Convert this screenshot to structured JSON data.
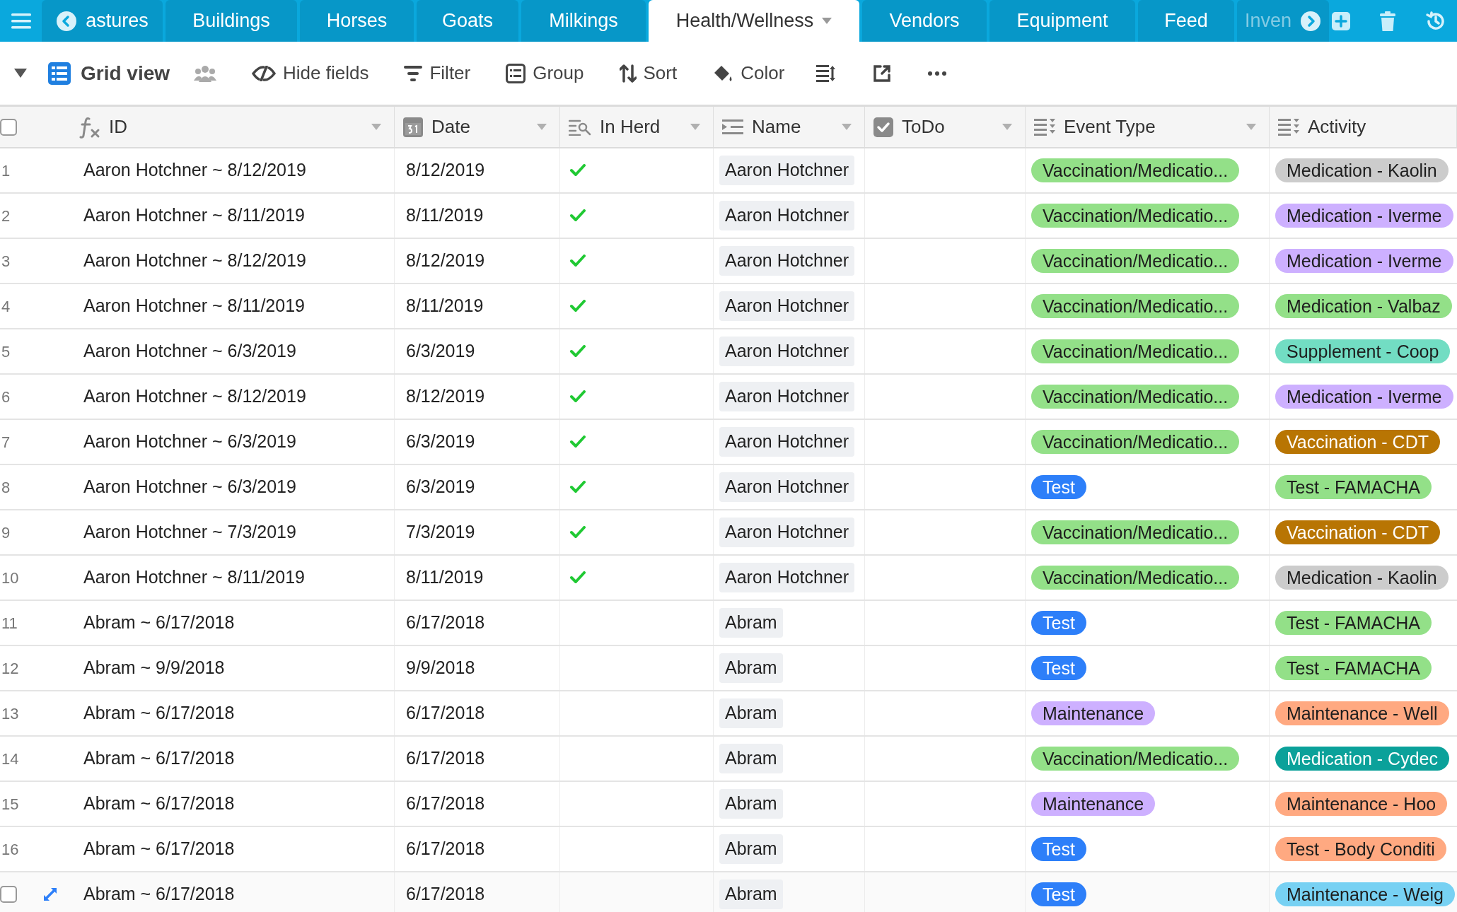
{
  "tabs": [
    {
      "label": "astures",
      "selected": false
    },
    {
      "label": "Buildings",
      "selected": false
    },
    {
      "label": "Horses",
      "selected": false
    },
    {
      "label": "Goats",
      "selected": false
    },
    {
      "label": "Milkings",
      "selected": false
    },
    {
      "label": "Health/Wellness",
      "selected": true
    },
    {
      "label": "Vendors",
      "selected": false
    },
    {
      "label": "Equipment",
      "selected": false
    },
    {
      "label": "Feed",
      "selected": false
    },
    {
      "label": "Inven",
      "selected": false
    }
  ],
  "select_all": {
    "checked": false
  },
  "view": {
    "name": "Grid view"
  },
  "toolbar": [
    {
      "label": "Hide fields",
      "kind": "hide"
    },
    {
      "label": "Filter",
      "kind": "filter"
    },
    {
      "label": "Group",
      "kind": "group"
    },
    {
      "label": "Sort",
      "kind": "sort"
    },
    {
      "label": "Color",
      "kind": "color"
    }
  ],
  "columns": [
    {
      "label": "ID",
      "kind": "formula"
    },
    {
      "label": "Date",
      "kind": "date"
    },
    {
      "label": "In Herd",
      "kind": "lookup"
    },
    {
      "label": "Name",
      "kind": "link"
    },
    {
      "label": "ToDo",
      "kind": "checkbox"
    },
    {
      "label": "Event Type",
      "kind": "select"
    },
    {
      "label": "Activity",
      "kind": "select"
    }
  ],
  "rows": [
    {
      "number": "1",
      "hovered": false,
      "id": "Aaron Hotchner ~ 8/12/2019",
      "date": "8/12/2019",
      "in_herd": true,
      "name": "Aaron Hotchner",
      "event_type": {
        "label": "Vaccination/Medicatio...",
        "color": "#93e088"
      },
      "activity": {
        "label": "Medication - Kaolin",
        "color": "#cccccc"
      }
    },
    {
      "number": "2",
      "hovered": false,
      "id": "Aaron Hotchner ~ 8/11/2019",
      "date": "8/11/2019",
      "in_herd": true,
      "name": "Aaron Hotchner",
      "event_type": {
        "label": "Vaccination/Medicatio...",
        "color": "#93e088"
      },
      "activity": {
        "label": "Medication - Iverme",
        "color": "#cdb0ff"
      }
    },
    {
      "number": "3",
      "hovered": false,
      "id": "Aaron Hotchner ~ 8/12/2019",
      "date": "8/12/2019",
      "in_herd": true,
      "name": "Aaron Hotchner",
      "event_type": {
        "label": "Vaccination/Medicatio...",
        "color": "#93e088"
      },
      "activity": {
        "label": "Medication - Iverme",
        "color": "#cdb0ff"
      }
    },
    {
      "number": "4",
      "hovered": false,
      "id": "Aaron Hotchner ~ 8/11/2019",
      "date": "8/11/2019",
      "in_herd": true,
      "name": "Aaron Hotchner",
      "event_type": {
        "label": "Vaccination/Medicatio...",
        "color": "#93e088"
      },
      "activity": {
        "label": "Medication - Valbaz",
        "color": "#93e088"
      }
    },
    {
      "number": "5",
      "hovered": false,
      "id": "Aaron Hotchner ~ 6/3/2019",
      "date": "6/3/2019",
      "in_herd": true,
      "name": "Aaron Hotchner",
      "event_type": {
        "label": "Vaccination/Medicatio...",
        "color": "#93e088"
      },
      "activity": {
        "label": "Supplement - Coop",
        "color": "#72ddc3"
      }
    },
    {
      "number": "6",
      "hovered": false,
      "id": "Aaron Hotchner ~ 8/12/2019",
      "date": "8/12/2019",
      "in_herd": true,
      "name": "Aaron Hotchner",
      "event_type": {
        "label": "Vaccination/Medicatio...",
        "color": "#93e088"
      },
      "activity": {
        "label": "Medication - Iverme",
        "color": "#cdb0ff"
      }
    },
    {
      "number": "7",
      "hovered": false,
      "id": "Aaron Hotchner ~ 6/3/2019",
      "date": "6/3/2019",
      "in_herd": true,
      "name": "Aaron Hotchner",
      "event_type": {
        "label": "Vaccination/Medicatio...",
        "color": "#93e088"
      },
      "activity": {
        "label": "Vaccination - CDT",
        "color": "#b87503"
      }
    },
    {
      "number": "8",
      "hovered": false,
      "id": "Aaron Hotchner ~ 6/3/2019",
      "date": "6/3/2019",
      "in_herd": true,
      "name": "Aaron Hotchner",
      "event_type": {
        "label": "Test",
        "color": "#2d7ff9"
      },
      "activity": {
        "label": "Test - FAMACHA",
        "color": "#93e088"
      }
    },
    {
      "number": "9",
      "hovered": false,
      "id": "Aaron Hotchner ~ 7/3/2019",
      "date": "7/3/2019",
      "in_herd": true,
      "name": "Aaron Hotchner",
      "event_type": {
        "label": "Vaccination/Medicatio...",
        "color": "#93e088"
      },
      "activity": {
        "label": "Vaccination - CDT",
        "color": "#b87503"
      }
    },
    {
      "number": "10",
      "hovered": false,
      "id": "Aaron Hotchner ~ 8/11/2019",
      "date": "8/11/2019",
      "in_herd": true,
      "name": "Aaron Hotchner",
      "event_type": {
        "label": "Vaccination/Medicatio...",
        "color": "#93e088"
      },
      "activity": {
        "label": "Medication - Kaolin",
        "color": "#cccccc"
      }
    },
    {
      "number": "11",
      "hovered": false,
      "id": "Abram ~ 6/17/2018",
      "date": "6/17/2018",
      "in_herd": false,
      "name": "Abram",
      "event_type": {
        "label": "Test",
        "color": "#2d7ff9"
      },
      "activity": {
        "label": "Test - FAMACHA",
        "color": "#93e088"
      }
    },
    {
      "number": "12",
      "hovered": false,
      "id": "Abram ~ 9/9/2018",
      "date": "9/9/2018",
      "in_herd": false,
      "name": "Abram",
      "event_type": {
        "label": "Test",
        "color": "#2d7ff9"
      },
      "activity": {
        "label": "Test - FAMACHA",
        "color": "#93e088"
      }
    },
    {
      "number": "13",
      "hovered": false,
      "id": "Abram ~ 6/17/2018",
      "date": "6/17/2018",
      "in_herd": false,
      "name": "Abram",
      "event_type": {
        "label": "Maintenance",
        "color": "#cdb0ff"
      },
      "activity": {
        "label": "Maintenance - Well",
        "color": "#ffa981"
      }
    },
    {
      "number": "14",
      "hovered": false,
      "id": "Abram ~ 6/17/2018",
      "date": "6/17/2018",
      "in_herd": false,
      "name": "Abram",
      "event_type": {
        "label": "Vaccination/Medicatio...",
        "color": "#93e088"
      },
      "activity": {
        "label": "Medication - Cydec",
        "color": "#0ba19a"
      }
    },
    {
      "number": "15",
      "hovered": false,
      "id": "Abram ~ 6/17/2018",
      "date": "6/17/2018",
      "in_herd": false,
      "name": "Abram",
      "event_type": {
        "label": "Maintenance",
        "color": "#cdb0ff"
      },
      "activity": {
        "label": "Maintenance - Hoo",
        "color": "#ffa981"
      }
    },
    {
      "number": "16",
      "hovered": false,
      "id": "Abram ~ 6/17/2018",
      "date": "6/17/2018",
      "in_herd": false,
      "name": "Abram",
      "event_type": {
        "label": "Test",
        "color": "#2d7ff9"
      },
      "activity": {
        "label": "Test - Body Conditi",
        "color": "#ffa981"
      }
    },
    {
      "hovered": true,
      "checked": false,
      "id": "Abram ~ 6/17/2018",
      "date": "6/17/2018",
      "in_herd": false,
      "name": "Abram",
      "event_type": {
        "label": "Test",
        "color": "#2d7ff9"
      },
      "activity": {
        "label": "Maintenance - Weig",
        "color": "#77d1f3"
      }
    }
  ]
}
